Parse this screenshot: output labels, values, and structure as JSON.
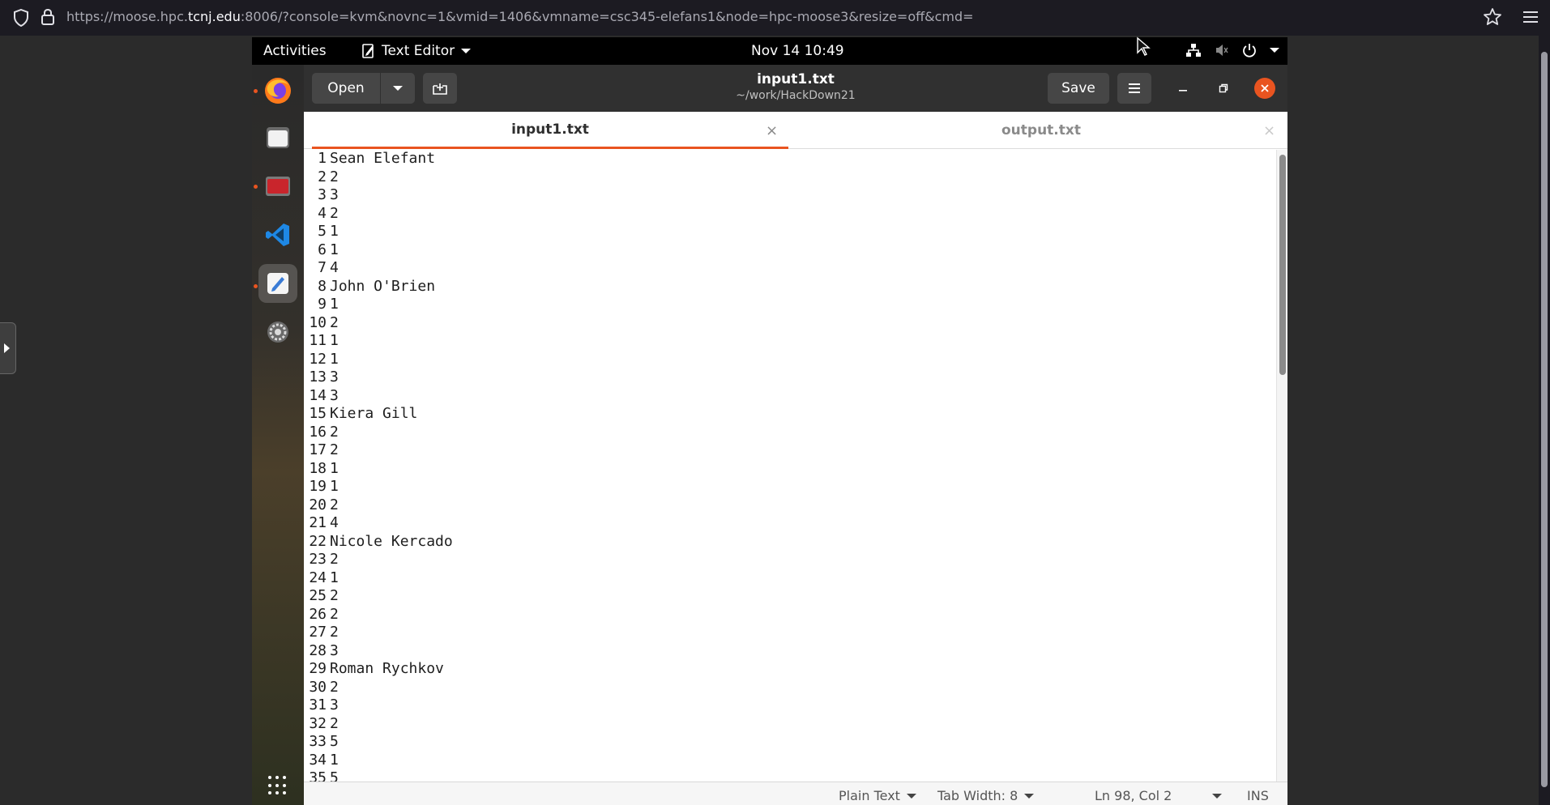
{
  "browser": {
    "url_prefix": "https://moose.hpc.",
    "url_host": "tcnj.edu",
    "url_rest": ":8006/?console=kvm&novnc=1&vmid=1406&vmname=csc345-elefans1&node=hpc-moose3&resize=off&cmd="
  },
  "topbar": {
    "activities": "Activities",
    "app_name": "Text Editor",
    "clock": "Nov 14  10:49"
  },
  "window": {
    "open_label": "Open",
    "save_label": "Save",
    "title": "input1.txt",
    "subtitle": "~/work/HackDown21"
  },
  "tabs": [
    {
      "label": "input1.txt",
      "close": "×"
    },
    {
      "label": "output.txt",
      "close": "×"
    }
  ],
  "lines": [
    "Sean Elefant",
    "2",
    "3",
    "2",
    "1",
    "1",
    "4",
    "John O'Brien",
    "1",
    "2",
    "1",
    "1",
    "3",
    "3",
    "Kiera Gill",
    "2",
    "2",
    "1",
    "1",
    "2",
    "4",
    "Nicole Kercado",
    "2",
    "1",
    "2",
    "2",
    "2",
    "3",
    "Roman Rychkov",
    "2",
    "3",
    "2",
    "5",
    "1",
    "5"
  ],
  "statusbar": {
    "syntax": "Plain Text",
    "tab_width": "Tab Width: 8",
    "position": "Ln 98, Col 2",
    "mode": "INS"
  },
  "colors": {
    "accent": "#e95420",
    "header": "#303030",
    "topbar": "#000000"
  }
}
